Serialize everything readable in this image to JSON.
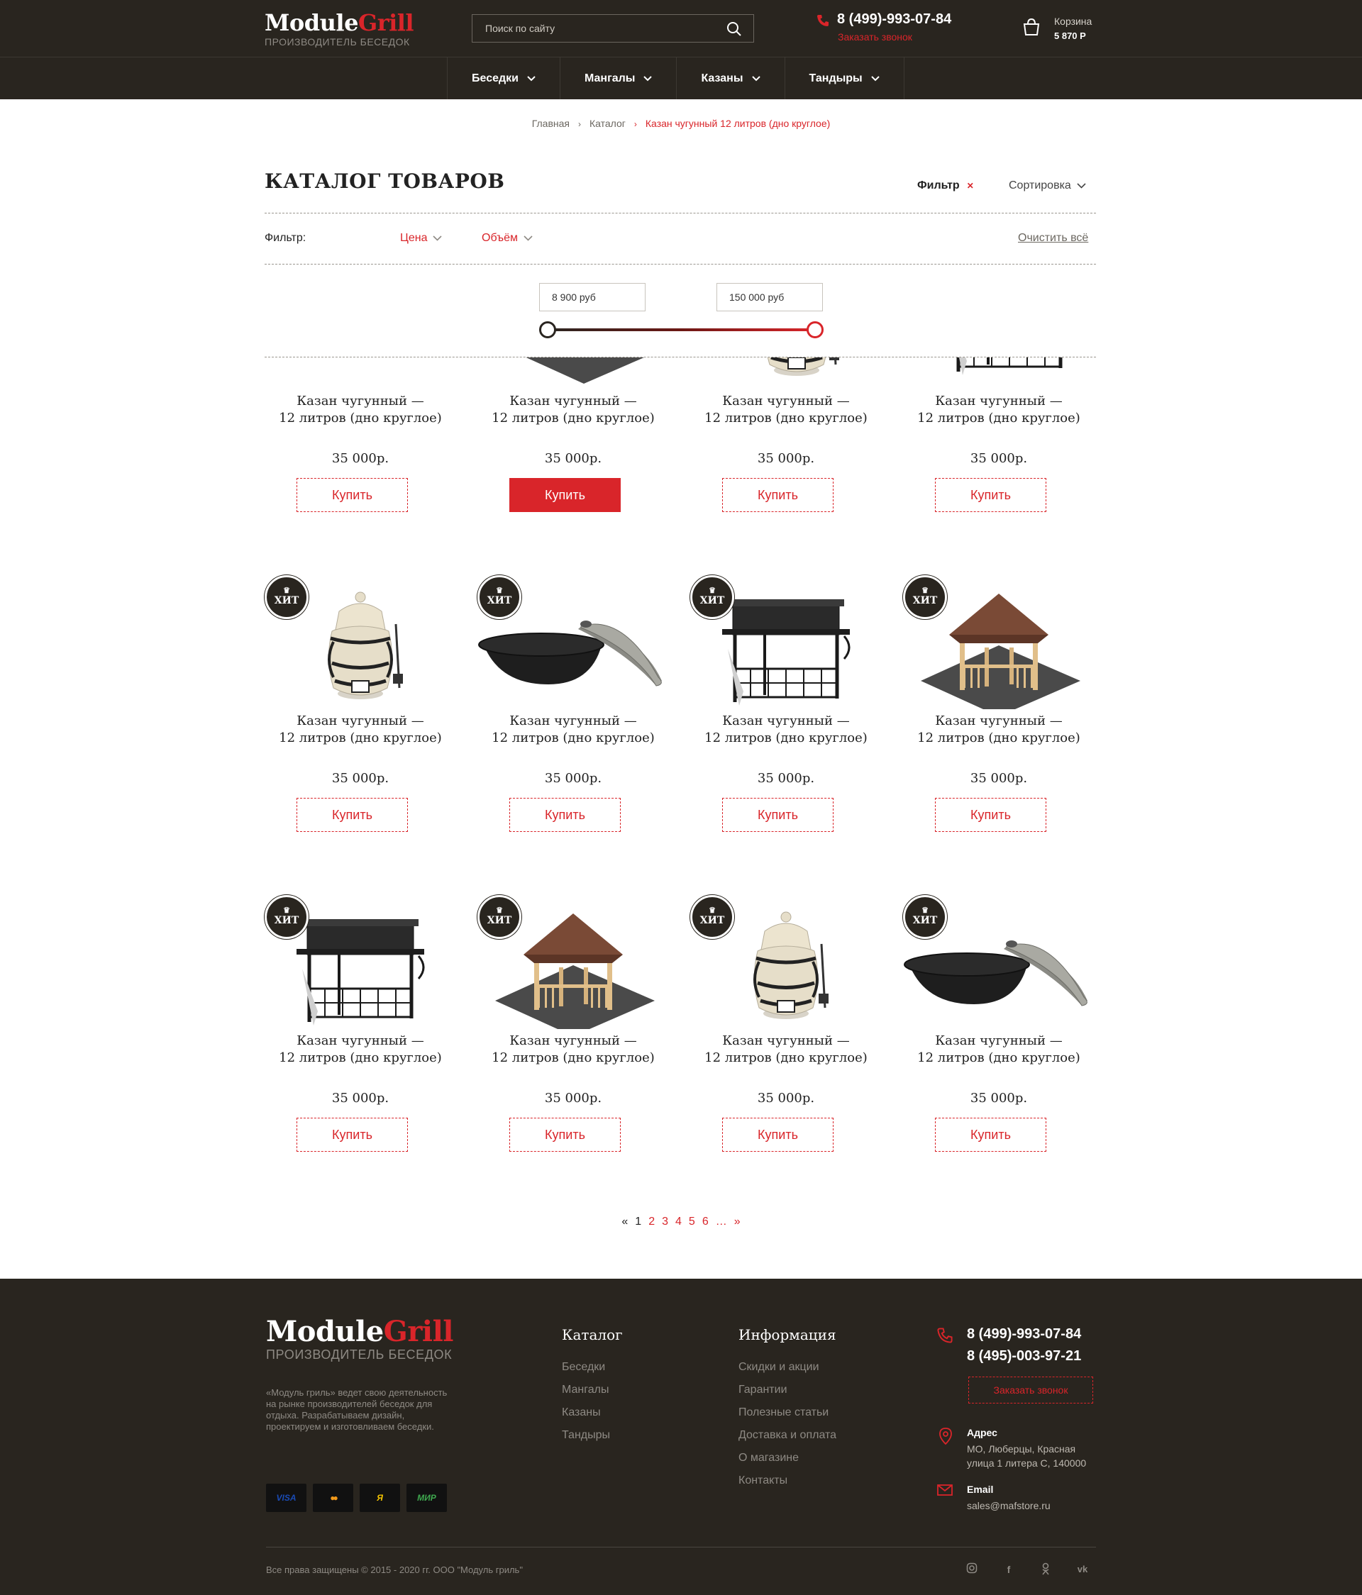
{
  "header": {
    "brand_part1": "Module",
    "brand_part2": "Grill",
    "tagline": "ПРОИЗВОДИТЕЛЬ БЕСЕДОК",
    "search_placeholder": "Поиск по сайту",
    "phone": "8 (499)-993-07-84",
    "callback": "Заказать звонок",
    "cart_label": "Корзина",
    "cart_total": "5 870 Р"
  },
  "nav": [
    {
      "label": "Беседки"
    },
    {
      "label": "Мангалы"
    },
    {
      "label": "Казаны"
    },
    {
      "label": "Тандыры"
    }
  ],
  "breadcrumb": {
    "home": "Главная",
    "catalog": "Каталог",
    "current": "Казан чугунный 12 литров (дно круглое)"
  },
  "catalog": {
    "title": "КАТАЛОГ ТОВАРОВ",
    "filter_toggle": "Фильтр",
    "filter_close": "✕",
    "sort_toggle": "Сортировка"
  },
  "filters": {
    "label": "Фильтр:",
    "price": "Цена",
    "volume": "Объём",
    "clear": "Очистить всё",
    "price_min": "8 900 руб",
    "price_max": "150 000 руб",
    "slider_min_fraction": 0,
    "slider_max_fraction": 1
  },
  "hit_label": "ХИТ",
  "products": {
    "row1": [
      {
        "name1": "Казан чугунный —",
        "name2": "12 литров (дно круглое)",
        "price": "35 000р.",
        "buy": "Купить",
        "active": false
      },
      {
        "name1": "Казан чугунный —",
        "name2": "12 литров (дно круглое)",
        "price": "35 000р.",
        "buy": "Купить",
        "active": true
      },
      {
        "name1": "Казан чугунный —",
        "name2": "12 литров (дно круглое)",
        "price": "35 000р.",
        "buy": "Купить",
        "active": false
      },
      {
        "name1": "Казан чугунный —",
        "name2": "12 литров (дно круглое)",
        "price": "35 000р.",
        "buy": "Купить",
        "active": false
      }
    ],
    "row2": [
      {
        "image": "tandoor-icon",
        "name1": "Казан чугунный —",
        "name2": "12 литров (дно круглое)",
        "price": "35 000р.",
        "buy": "Купить"
      },
      {
        "image": "kazan-icon",
        "name1": "Казан чугунный —",
        "name2": "12 литров (дно круглое)",
        "price": "35 000р.",
        "buy": "Купить"
      },
      {
        "image": "grill-icon",
        "name1": "Казан чугунный —",
        "name2": "12 литров (дно круглое)",
        "price": "35 000р.",
        "buy": "Купить"
      },
      {
        "image": "gazebo-icon",
        "name1": "Казан чугунный —",
        "name2": "12 литров (дно круглое)",
        "price": "35 000р.",
        "buy": "Купить"
      }
    ],
    "row3": [
      {
        "image": "grill-icon",
        "name1": "Казан чугунный —",
        "name2": "12 литров (дно круглое)",
        "price": "35 000р.",
        "buy": "Купить"
      },
      {
        "image": "gazebo-icon",
        "name1": "Казан чугунный —",
        "name2": "12 литров (дно круглое)",
        "price": "35 000р.",
        "buy": "Купить"
      },
      {
        "image": "tandoor-icon",
        "name1": "Казан чугунный —",
        "name2": "12 литров (дно круглое)",
        "price": "35 000р.",
        "buy": "Купить"
      },
      {
        "image": "kazan-icon",
        "name1": "Казан чугунный —",
        "name2": "12 литров (дно круглое)",
        "price": "35 000р.",
        "buy": "Купить"
      }
    ]
  },
  "pagination": {
    "prev": "«",
    "pages": [
      "1",
      "2",
      "3",
      "4",
      "5",
      "6"
    ],
    "ellipsis": "…",
    "next": "»",
    "current": "1"
  },
  "footer": {
    "brand_part1": "Module",
    "brand_part2": "Grill",
    "tagline": "ПРОИЗВОДИТЕЛЬ БЕСЕДОК",
    "about": "«Модуль гриль» ведет свою деятельность на рынке производителей беседок для отдыха. Разрабатываем дизайн, проектируем и изготовливаем беседки.",
    "payments": [
      "VISA",
      "●●",
      "Я",
      "МИР"
    ],
    "catalog_title": "Каталог",
    "catalog_links": [
      "Беседки",
      "Мангалы",
      "Казаны",
      "Тандыры"
    ],
    "info_title": "Информация",
    "info_links": [
      "Скидки и акции",
      "Гарантии",
      "Полезные статьи",
      "Доставка и оплата",
      "О магазине",
      "Контакты"
    ],
    "phone1": "8 (499)-993-07-84",
    "phone2": "8 (495)-003-97-21",
    "callback": "Заказать звонок",
    "address_label": "Адрес",
    "address_line1": "МО, Люберцы, Красная",
    "address_line2": "улица 1 литера С, 140000",
    "email_label": "Email",
    "email": "sales@mafstore.ru",
    "copyright": "Все права защищены © 2015 - 2020 гг. ООО \"Модуль гриль\"",
    "socials": [
      "instagram-icon",
      "facebook-icon",
      "odnoklassniki-icon",
      "vk-icon"
    ]
  },
  "colors": {
    "dark": "#29251f",
    "accent": "#d9252a"
  }
}
